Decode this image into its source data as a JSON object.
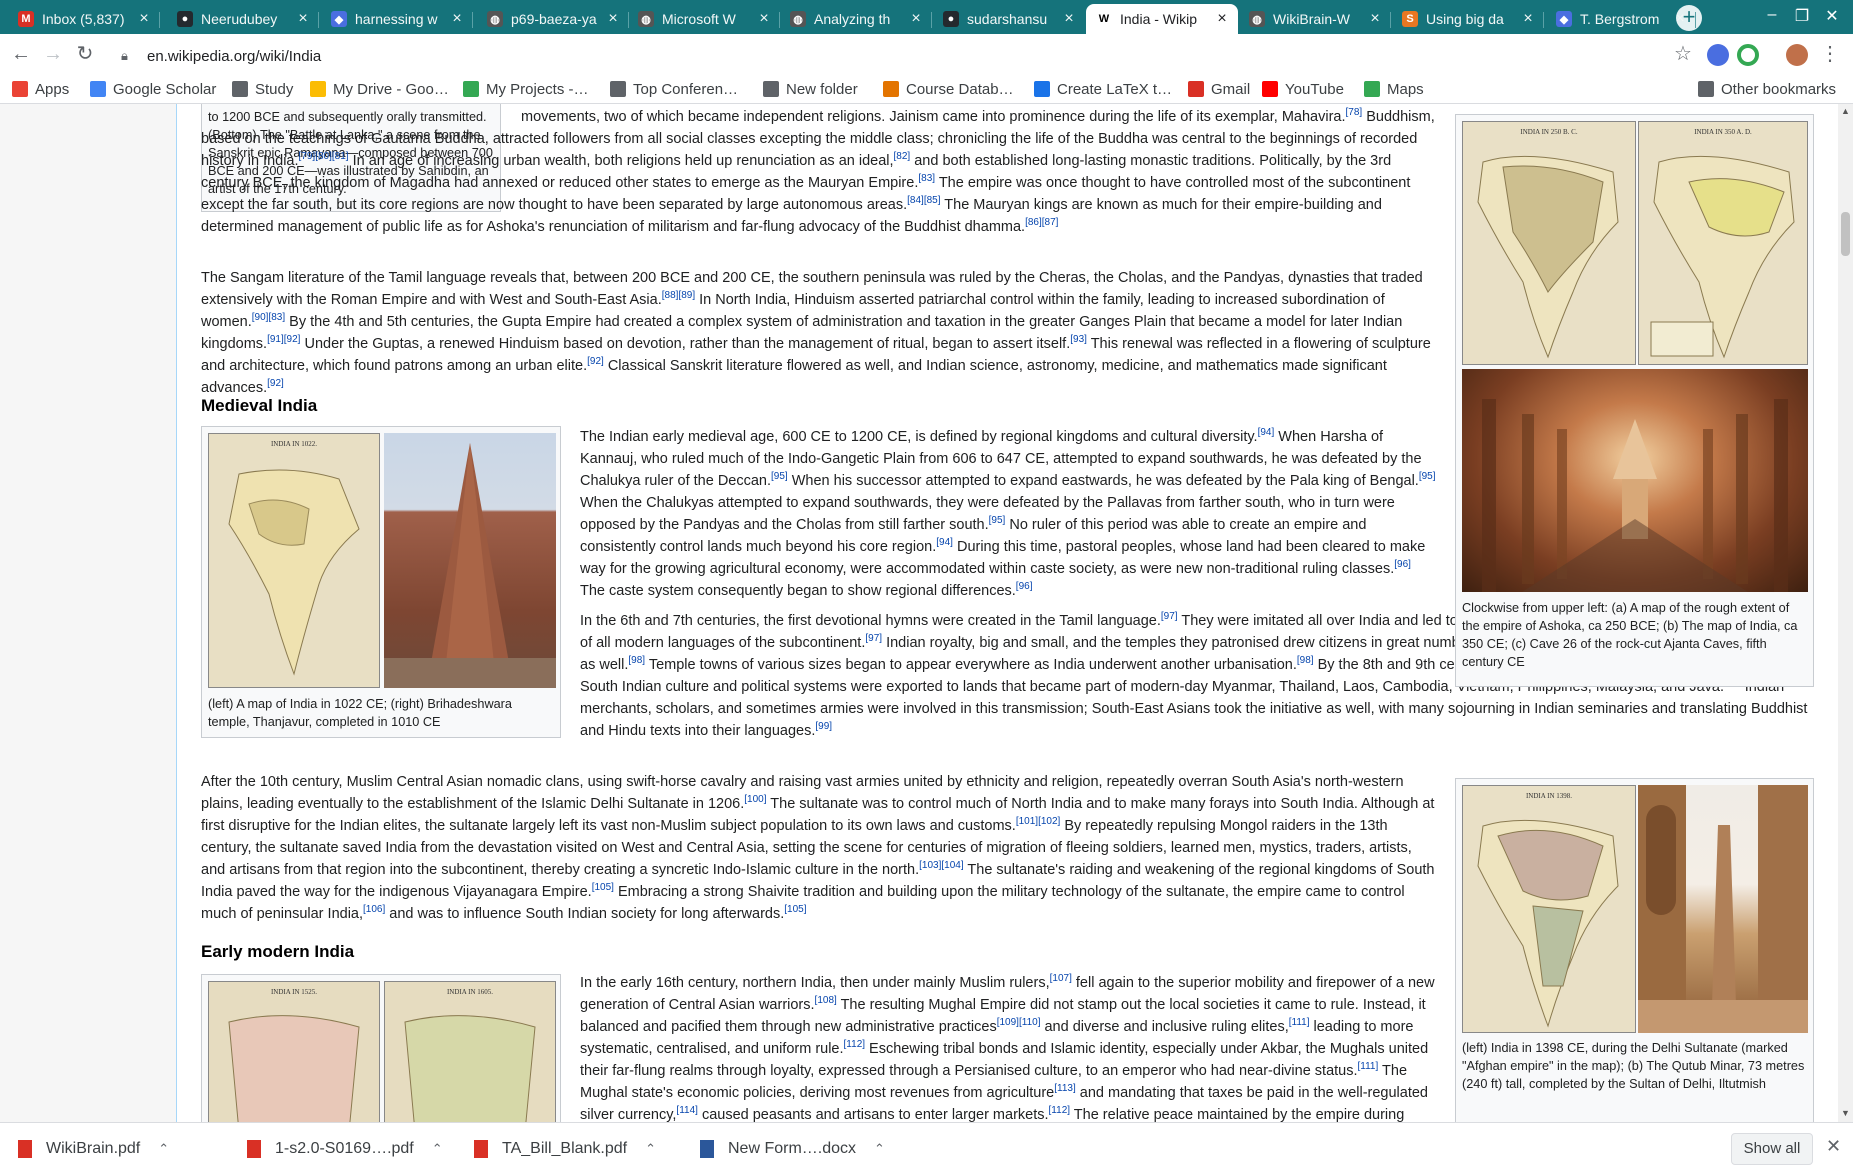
{
  "browser": {
    "tabs": [
      {
        "title": "Inbox (5,837)",
        "icon": "gmail-icon",
        "color": "#d93025",
        "glyph": "M"
      },
      {
        "title": "Neerudubey",
        "icon": "github-icon",
        "color": "#24292e",
        "glyph": "●"
      },
      {
        "title": "harnessing w",
        "icon": "shield-icon",
        "color": "#4a6ee0",
        "glyph": "◆"
      },
      {
        "title": "p69-baeza-ya",
        "icon": "globe-icon",
        "color": "#555",
        "glyph": "◍"
      },
      {
        "title": "Microsoft W",
        "icon": "globe-icon",
        "color": "#555",
        "glyph": "◍"
      },
      {
        "title": "Analyzing th",
        "icon": "globe-icon",
        "color": "#555",
        "glyph": "◍"
      },
      {
        "title": "sudarshansu",
        "icon": "github-icon",
        "color": "#24292e",
        "glyph": "●"
      },
      {
        "title": "India - Wikip",
        "icon": "wikipedia-icon",
        "color": "#ffffff",
        "glyph": "W"
      },
      {
        "title": "WikiBrain-W",
        "icon": "globe-icon",
        "color": "#555",
        "glyph": "◍"
      },
      {
        "title": "Using big da",
        "icon": "springer-icon",
        "color": "#e87722",
        "glyph": "S"
      },
      {
        "title": "T. Bergstrom",
        "icon": "shield-icon",
        "color": "#4a6ee0",
        "glyph": "◆"
      }
    ],
    "url": "en.wikipedia.org/wiki/India",
    "bookmarks": [
      {
        "label": "Apps",
        "color": "#ea4335"
      },
      {
        "label": "Google Scholar",
        "color": "#4285f4"
      },
      {
        "label": "Study",
        "color": "#5f6368"
      },
      {
        "label": "My Drive - Goo…",
        "color": "#fbbc04"
      },
      {
        "label": "My Projects -…",
        "color": "#34a853"
      },
      {
        "label": "Top Conferen…",
        "color": "#5f6368"
      },
      {
        "label": "New folder",
        "color": "#5f6368"
      },
      {
        "label": "Course Datab…",
        "color": "#e37400"
      },
      {
        "label": "Create LaTeX t…",
        "color": "#1a73e8"
      },
      {
        "label": "Gmail",
        "color": "#d93025"
      },
      {
        "label": "YouTube",
        "color": "#ff0000"
      },
      {
        "label": "Maps",
        "color": "#34a853"
      }
    ],
    "other_bookmarks": "Other bookmarks"
  },
  "article": {
    "top_caption": "to 1200 BCE and subsequently orally transmitted. (Bottom) The \"Battle at Lanka,\" a scene from the Sanskrit epic Ramayana—composed between 700 BCE and 200 CE—was illustrated by Sahibdin, an artist of the 17th century.",
    "p1": "movements, two of which became independent religions. Jainism came into prominence during the life of its exemplar, Mahavira.[78] Buddhism, based on the teachings of Gautama Buddha, attracted followers from all social classes excepting the middle class; chronicling the life of the Buddha was central to the beginnings of recorded history in India.[79][80][81] In an age of increasing urban wealth, both religions held up renunciation as an ideal,[82] and both established long-lasting monastic traditions. Politically, by the 3rd century BCE, the kingdom of Magadha had annexed or reduced other states to emerge as the Mauryan Empire.[83] The empire was once thought to have controlled most of the subcontinent except the far south, but its core regions are now thought to have been separated by large autonomous areas.[84][85] The Mauryan kings are known as much for their empire-building and determined management of public life as for Ashoka's renunciation of militarism and far-flung advocacy of the Buddhist dhamma.[86][87]",
    "p2": "The Sangam literature of the Tamil language reveals that, between 200 BCE and 200 CE, the southern peninsula was ruled by the Cheras, the Cholas, and the Pandyas, dynasties that traded extensively with the Roman Empire and with West and South-East Asia.[88][89] In North India, Hinduism asserted patriarchal control within the family, leading to increased subordination of women.[90][83] By the 4th and 5th centuries, the Gupta Empire had created a complex system of administration and taxation in the greater Ganges Plain that became a model for later Indian kingdoms.[91][92] Under the Guptas, a renewed Hinduism based on devotion, rather than the management of ritual, began to assert itself.[93] This renewal was reflected in a flowering of sculpture and architecture, which found patrons among an urban elite.[92] Classical Sanskrit literature flowered as well, and Indian science, astronomy, medicine, and mathematics made significant advances.[92]",
    "h_medieval": "Medieval India",
    "p3": "The Indian early medieval age, 600 CE to 1200 CE, is defined by regional kingdoms and cultural diversity.[94] When Harsha of Kannauj, who ruled much of the Indo-Gangetic Plain from 606 to 647 CE, attempted to expand southwards, he was defeated by the Chalukya ruler of the Deccan.[95] When his successor attempted to expand eastwards, he was defeated by the Pala king of Bengal.[95] When the Chalukyas attempted to expand southwards, they were defeated by the Pallavas from farther south, who in turn were opposed by the Pandyas and the Cholas from still farther south.[95] No ruler of this period was able to create an empire and consistently control lands much beyond his core region.[94] During this time, pastoral peoples, whose land had been cleared to make way for the growing agricultural economy, were accommodated within caste society, as were new non-traditional ruling classes.[96] The caste system consequently began to show regional differences.[96]",
    "p4": "In the 6th and 7th centuries, the first devotional hymns were created in the Tamil language.[97] They were imitated all over India and led to both the resurgence of Hinduism and the development of all modern languages of the subcontinent.[97] Indian royalty, big and small, and the temples they patronised drew citizens in great numbers to the capital cities, which became economic hubs as well.[98] Temple towns of various sizes began to appear everywhere as India underwent another urbanisation.[98] By the 8th and 9th centuries, the effects were felt in South-East Asia, as South Indian culture and political systems were exported to lands that became part of modern-day Myanmar, Thailand, Laos, Cambodia, Vietnam, Philippines, Malaysia, and Java.[99] Indian merchants, scholars, and sometimes armies were involved in this transmission; South-East Asians took the initiative as well, with many sojourning in Indian seminaries and translating Buddhist and Hindu texts into their languages.[99]",
    "p5": "After the 10th century, Muslim Central Asian nomadic clans, using swift-horse cavalry and raising vast armies united by ethnicity and religion, repeatedly overran South Asia's north-western plains, leading eventually to the establishment of the Islamic Delhi Sultanate in 1206.[100] The sultanate was to control much of North India and to make many forays into South India. Although at first disruptive for the Indian elites, the sultanate largely left its vast non-Muslim subject population to its own laws and customs.[101][102] By repeatedly repulsing Mongol raiders in the 13th century, the sultanate saved India from the devastation visited on West and Central Asia, setting the scene for centuries of migration of fleeing soldiers, learned men, mystics, traders, artists, and artisans from that region into the subcontinent, thereby creating a syncretic Indo-Islamic culture in the north.[103][104] The sultanate's raiding and weakening of the regional kingdoms of South India paved the way for the indigenous Vijayanagara Empire.[105] Embracing a strong Shaivite tradition and building upon the military technology of the sultanate, the empire came to control much of peninsular India,[106] and was to influence South Indian society for long afterwards.[105]",
    "h_earlymodern": "Early modern India",
    "p6": "In the early 16th century, northern India, then under mainly Muslim rulers,[107] fell again to the superior mobility and firepower of a new generation of Central Asian warriors.[108] The resulting Mughal Empire did not stamp out the local societies it came to rule. Instead, it balanced and pacified them through new administrative practices[109][110] and diverse and inclusive ruling elites,[111] leading to more systematic, centralised, and uniform rule.[112] Eschewing tribal bonds and Islamic identity, especially under Akbar, the Mughals united their far-flung realms through loyalty, expressed through a Persianised culture, to an emperor who had near-divine status.[111] The Mughal state's economic policies, deriving most revenues from agriculture[113] and mandating that taxes be paid in the well-regulated silver currency,[114] caused peasants and artisans to enter larger markets.[112] The relative peace maintained by the empire during much of the",
    "cap_right1": "Clockwise from upper left: (a) A map of the rough extent of the empire of Ashoka, ca 250 BCE; (b) The map of India, ca 350 CE; (c) Cave 26 of the rock-cut Ajanta Caves, fifth century CE",
    "cap_medieval": "(left) A map of India in 1022 CE; (right) Brihadeshwara temple, Thanjavur, completed in 1010 CE",
    "cap_right2": "(left) India in 1398 CE, during the Delhi Sultanate (marked \"Afghan empire\" in the map); (b) The Qutub Minar, 73 metres (240 ft) tall, completed by the Sultan of Delhi, Iltutmish",
    "map_labels": {
      "m250": "INDIA IN 250 B. C.",
      "m350": "INDIA IN 350 A. D.",
      "m1022": "INDIA IN 1022.",
      "m1398": "INDIA IN 1398.",
      "m1525": "INDIA IN 1525.",
      "m1605": "INDIA IN 1605."
    }
  },
  "downloads": {
    "items": [
      {
        "name": "WikiBrain.pdf",
        "type": "pdf"
      },
      {
        "name": "1-s2.0-S0169….pdf",
        "type": "pdf"
      },
      {
        "name": "TA_Bill_Blank.pdf",
        "type": "pdf"
      },
      {
        "name": "New Form….docx",
        "type": "docx"
      }
    ],
    "show_all": "Show all"
  }
}
